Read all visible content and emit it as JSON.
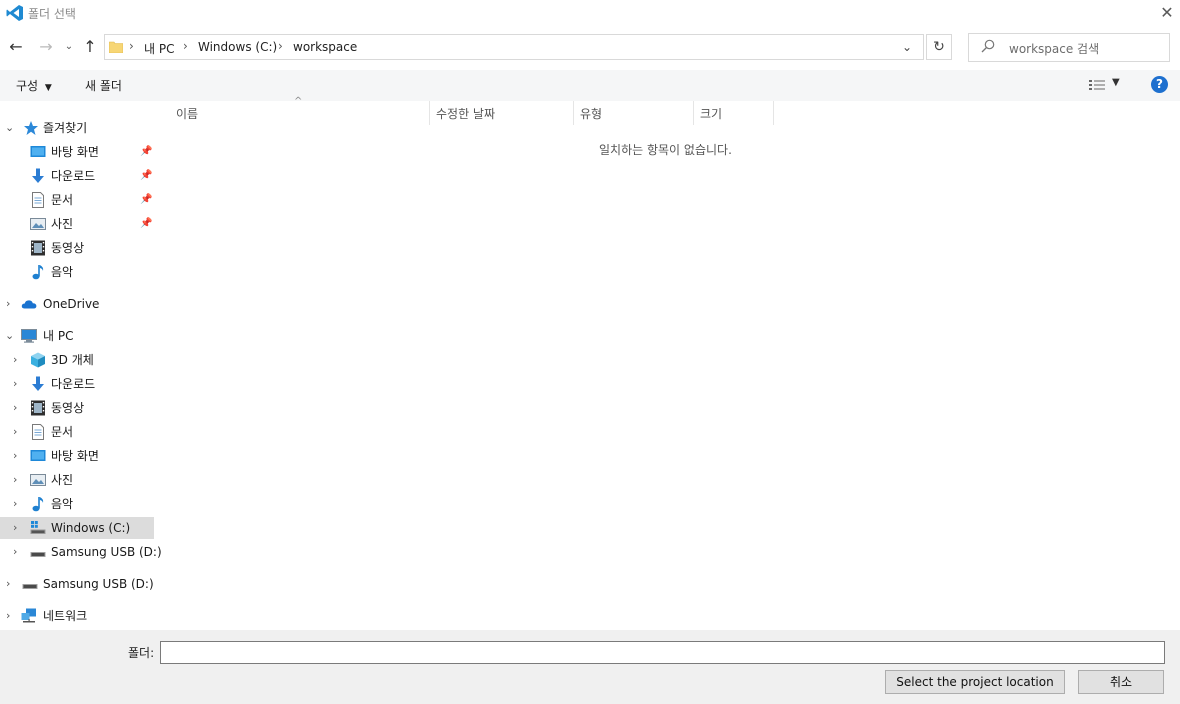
{
  "window": {
    "title": "폴더 선택"
  },
  "address": {
    "crumbs": [
      "내 PC",
      "Windows (C:)",
      "workspace"
    ]
  },
  "search": {
    "placeholder": "workspace 검색"
  },
  "commandbar": {
    "organize_label": "구성",
    "new_folder_label": "새 폴더",
    "help_label": "?"
  },
  "nav": {
    "quick_access": {
      "label": "즐겨찾기",
      "items": [
        {
          "label": "바탕 화면",
          "icon": "desktop-icon"
        },
        {
          "label": "다운로드",
          "icon": "download-icon"
        },
        {
          "label": "문서",
          "icon": "document-icon"
        },
        {
          "label": "사진",
          "icon": "picture-icon"
        },
        {
          "label": "동영상",
          "icon": "video-icon"
        },
        {
          "label": "음악",
          "icon": "music-icon"
        }
      ]
    },
    "onedrive": {
      "label": "OneDrive"
    },
    "this_pc": {
      "label": "내 PC",
      "items": [
        {
          "label": "3D 개체",
          "icon": "3d-objects-icon"
        },
        {
          "label": "다운로드",
          "icon": "download-icon"
        },
        {
          "label": "동영상",
          "icon": "video-icon"
        },
        {
          "label": "문서",
          "icon": "document-icon"
        },
        {
          "label": "바탕 화면",
          "icon": "desktop-icon"
        },
        {
          "label": "사진",
          "icon": "picture-icon"
        },
        {
          "label": "음악",
          "icon": "music-icon"
        },
        {
          "label": "Windows (C:)",
          "icon": "windows-drive-icon"
        },
        {
          "label": "Samsung USB (D:)",
          "icon": "usb-drive-icon"
        }
      ]
    },
    "usb": {
      "label": "Samsung USB (D:)"
    },
    "network": {
      "label": "네트워크"
    }
  },
  "columns": [
    "이름",
    "수정한 날짜",
    "유형",
    "크기"
  ],
  "empty_message": "일치하는 항목이 없습니다.",
  "footer": {
    "folder_label": "폴더:",
    "folder_value": "",
    "select_label": "Select the project location",
    "cancel_label": "취소"
  },
  "colors": {
    "accent": "#1e70cf",
    "selected_bg": "#dcdcdc",
    "command_bar_bg": "#f5f6f7",
    "footer_bg": "#f0f0f0"
  }
}
